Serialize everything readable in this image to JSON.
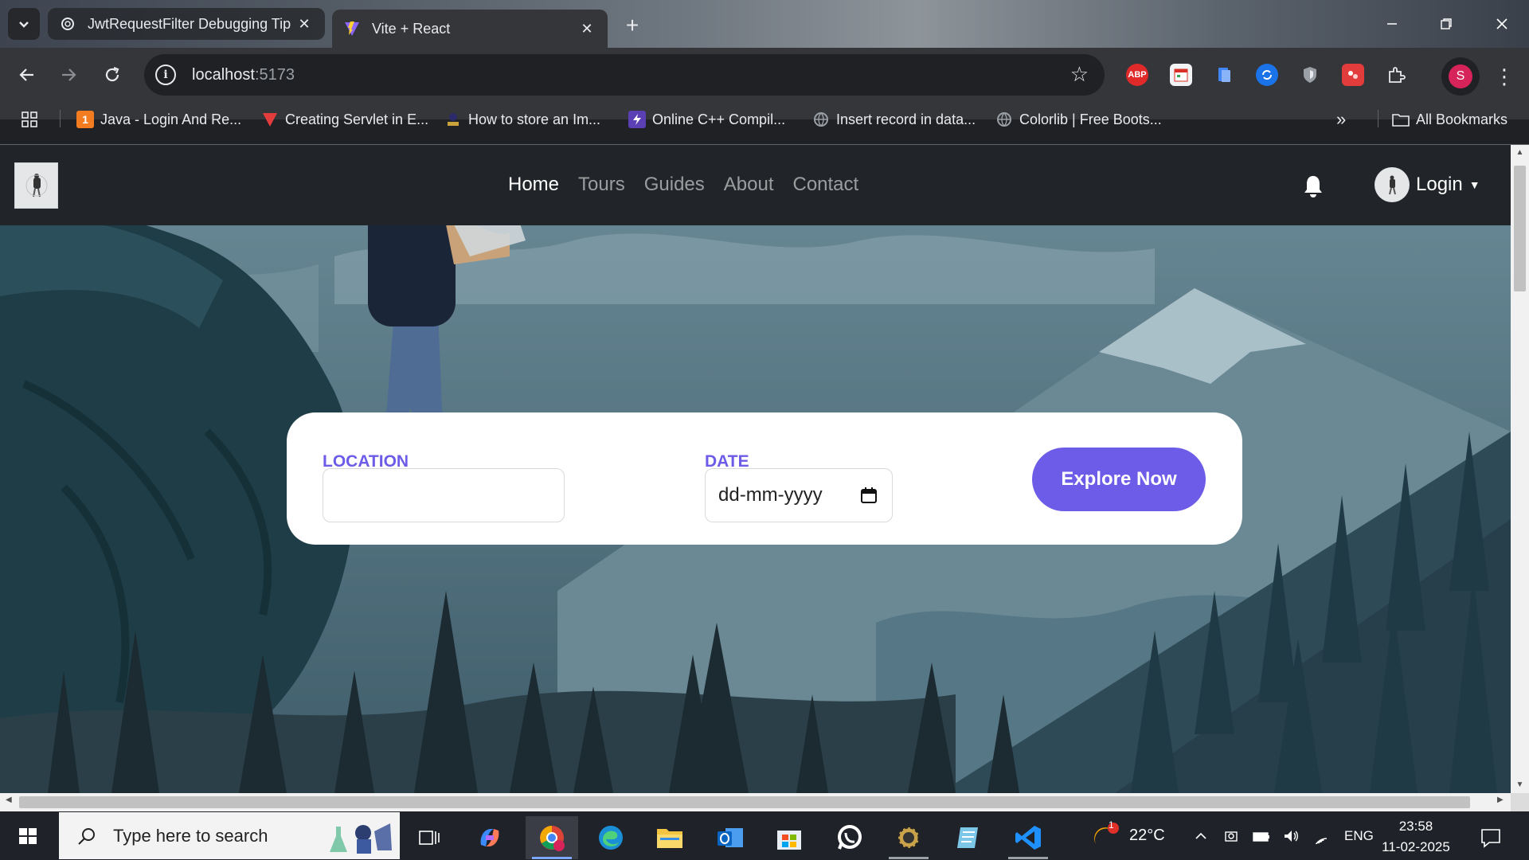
{
  "browser": {
    "tabs": [
      {
        "title": "JwtRequestFilter Debugging Tip",
        "active": false
      },
      {
        "title": "Vite + React",
        "active": true
      }
    ],
    "url_host": "localhost",
    "url_port": ":5173",
    "profile_initial": "S",
    "extensions": [
      "ABP"
    ],
    "bookmarks": [
      "Java - Login And Re...",
      "Creating Servlet in E...",
      "How to store an Im...",
      "Online C++ Compil...",
      "Insert record in data...",
      "Colorlib | Free Boots..."
    ],
    "all_bookmarks": "All Bookmarks",
    "more_bookmarks": "»"
  },
  "site": {
    "nav": [
      "Home",
      "Tours",
      "Guides",
      "About",
      "Contact"
    ],
    "active_nav": "Home",
    "login_label": "Login"
  },
  "search_form": {
    "location_label": "LOCATION",
    "location_value": "",
    "date_label": "DATE",
    "date_placeholder": "dd-mm-yyyy",
    "explore_button": "Explore Now"
  },
  "taskbar": {
    "search_placeholder": "Type here to search",
    "weather_temp": "22°C",
    "weather_badge": "1",
    "language": "ENG",
    "time": "23:58",
    "date": "11-02-2025"
  },
  "colors": {
    "accent": "#6c5ce7",
    "site_navbar": "#212529",
    "chrome_toolbar": "#35363a"
  }
}
